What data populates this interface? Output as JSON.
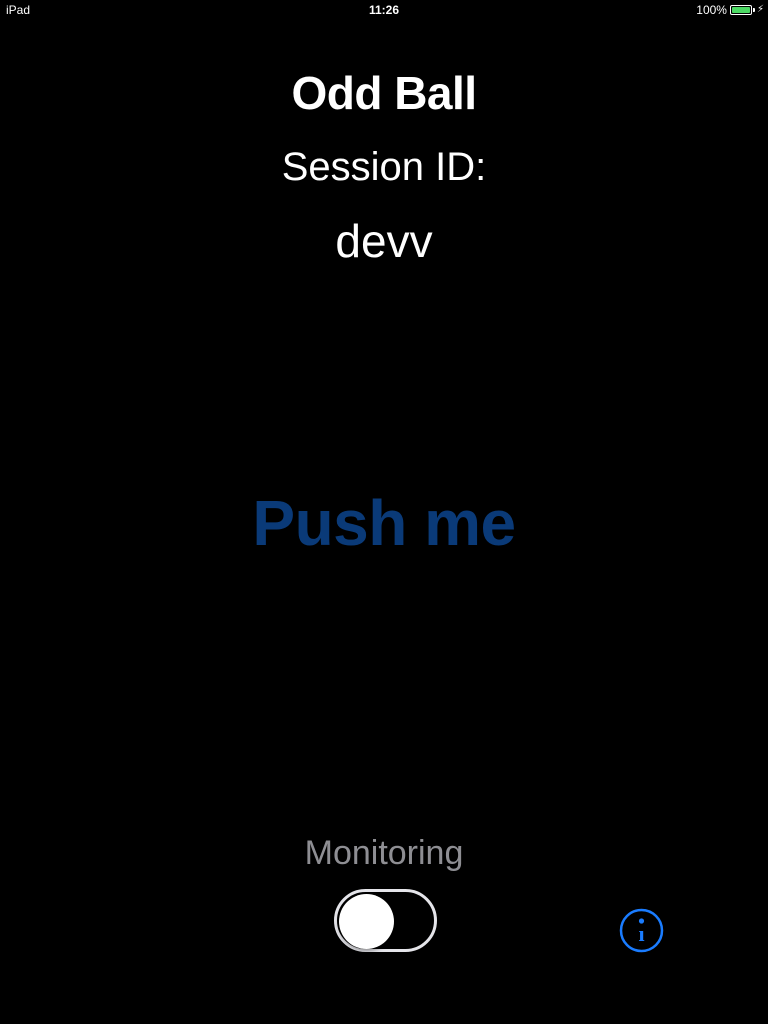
{
  "status_bar": {
    "device": "iPad",
    "time": "11:26",
    "battery_percent": "100%",
    "battery_level": 1.0,
    "charging_glyph": "⚡"
  },
  "app": {
    "title": "Odd Ball",
    "session_label": "Session ID:",
    "session_value": "devv",
    "push_button_label": "Push me",
    "monitoring_label": "Monitoring",
    "monitoring_enabled": false,
    "info_icon": "info-circle-icon"
  },
  "colors": {
    "background": "#000000",
    "push_button": "#0a3a78",
    "info_icon": "#1a7cff",
    "battery_fill": "#4cd964",
    "monitoring_text": "#8e8e93"
  }
}
